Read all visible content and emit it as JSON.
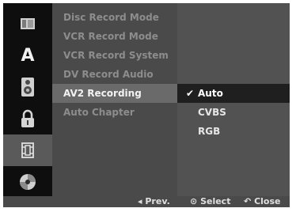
{
  "sidebar": {
    "items": [
      {
        "icon": "disc-menu-icon"
      },
      {
        "icon": "language-icon",
        "glyph": "A"
      },
      {
        "icon": "audio-speaker-icon"
      },
      {
        "icon": "lock-icon"
      },
      {
        "icon": "film-record-icon",
        "selected": true
      },
      {
        "icon": "disc-icon"
      }
    ]
  },
  "menu": {
    "items": [
      {
        "label": "Disc Record Mode"
      },
      {
        "label": "VCR Record Mode"
      },
      {
        "label": "VCR Record System"
      },
      {
        "label": "DV Record Audio"
      },
      {
        "label": "AV2 Recording",
        "selected": true
      },
      {
        "label": "Auto Chapter"
      }
    ]
  },
  "submenu": {
    "items": [
      {
        "label": "Auto",
        "checked": true
      },
      {
        "label": "CVBS"
      },
      {
        "label": "RGB"
      }
    ],
    "check_glyph": "✔"
  },
  "footer": {
    "prev_icon": "◂",
    "prev_label": "Prev.",
    "select_icon": "⊙",
    "select_label": "Select",
    "close_icon": "↶",
    "close_label": "Close"
  }
}
